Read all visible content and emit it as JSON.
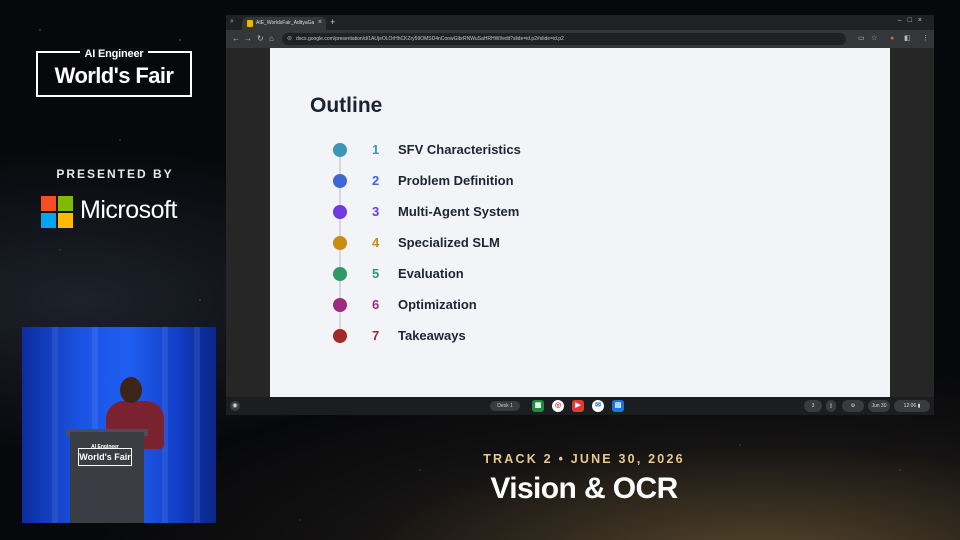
{
  "event": {
    "brand_sup": "AI Engineer",
    "brand_main": "World's Fair",
    "presented_by": "PRESENTED BY",
    "sponsor": "Microsoft",
    "track": "TRACK 2 • JUNE 30, 2026",
    "session": "Vision & OCR",
    "podium_sup": "AI Engineer",
    "podium_main": "World's Fair"
  },
  "browser": {
    "tab_title": "AIE_WorldsFair_AdityaGautam",
    "tab_close": "×",
    "new_tab": "+",
    "url": "docs.google.com/presentation/d/1AUjeOLOrHhCKZry59OMSD4nCoowGlbrRNWuSaHRHWI/edit?slide=id.p2#slide=id.p2",
    "icons": [
      "back-icon",
      "forward-icon",
      "reload-icon",
      "home-icon",
      "cast-icon",
      "star-icon",
      "extension-icon",
      "profile-icon",
      "menu-icon"
    ]
  },
  "slide": {
    "title": "Outline",
    "items": [
      {
        "num": "1",
        "label": "SFV Characteristics",
        "color": "#3b97b8"
      },
      {
        "num": "2",
        "label": "Problem Definition",
        "color": "#3e66d6"
      },
      {
        "num": "3",
        "label": "Multi-Agent System",
        "color": "#6d3be0"
      },
      {
        "num": "4",
        "label": "Specialized SLM",
        "color": "#c98c12"
      },
      {
        "num": "5",
        "label": "Evaluation",
        "color": "#2f9a68"
      },
      {
        "num": "6",
        "label": "Optimization",
        "color": "#a02a7d"
      },
      {
        "num": "7",
        "label": "Takeaways",
        "color": "#a32a2a"
      }
    ]
  },
  "shelf": {
    "desk_label": "Desk 1",
    "tray_count": "3",
    "date": "Jun 30",
    "time": "12:06"
  }
}
